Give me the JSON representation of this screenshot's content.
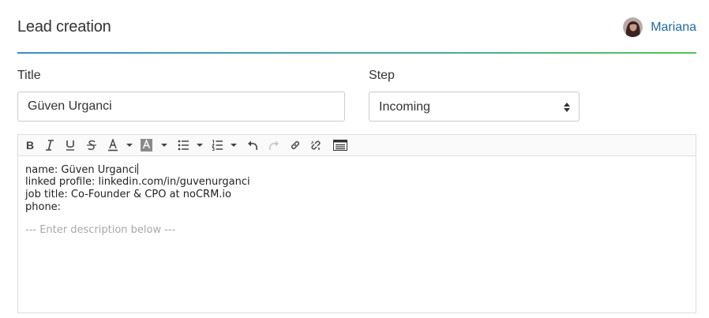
{
  "header": {
    "title": "Lead creation",
    "user_name": "Mariana"
  },
  "form": {
    "title_label": "Title",
    "title_value": "Güven Urganci",
    "step_label": "Step",
    "step_value": "Incoming"
  },
  "toolbar": {
    "buttons": [
      "bold",
      "italic",
      "underline",
      "strikethrough",
      "font-color",
      "background-color",
      "bulleted-list",
      "numbered-list",
      "undo",
      "redo",
      "link",
      "unlink",
      "source"
    ]
  },
  "editor": {
    "lines": [
      "name: Güven Urganci",
      "linked profile: linkedin.com/in/guvenurganci",
      "job title: Co-Founder & CPO at noCRM.io",
      "phone:"
    ],
    "description_marker": "--- Enter description below ---"
  },
  "colors": {
    "accent_link": "#1f6aa0",
    "header_gradient_start": "#3a8fbf",
    "header_gradient_end": "#52c45a"
  }
}
